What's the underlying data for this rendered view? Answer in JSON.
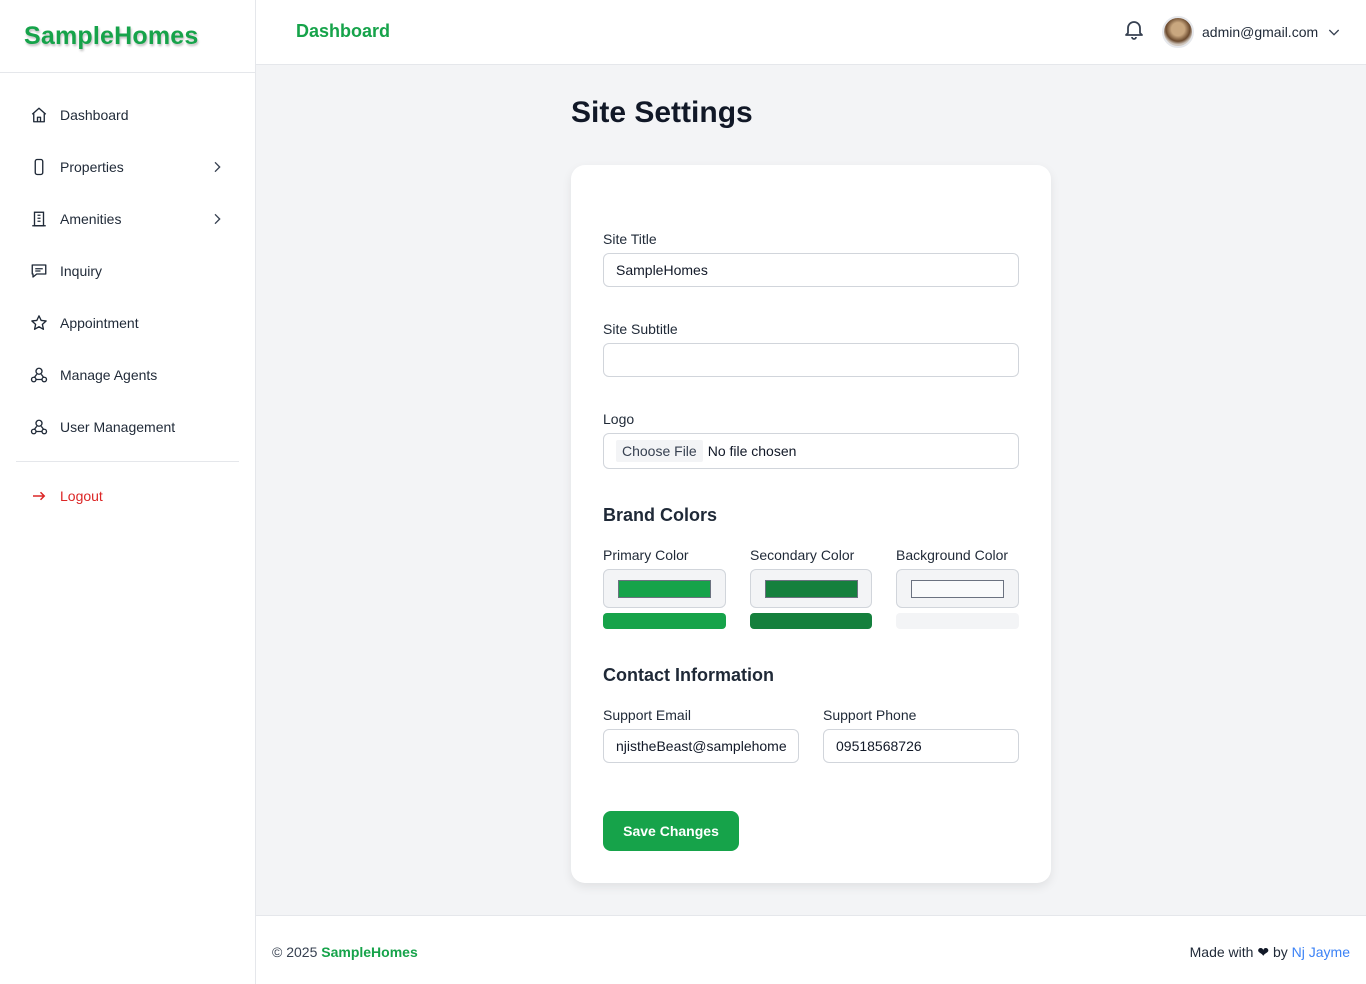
{
  "app": {
    "brand": "SampleHomes"
  },
  "sidebar": {
    "items": [
      {
        "label": "Dashboard",
        "icon": "home-icon"
      },
      {
        "label": "Properties",
        "icon": "phone-icon",
        "has_submenu": true
      },
      {
        "label": "Amenities",
        "icon": "building-icon",
        "has_submenu": true
      },
      {
        "label": "Inquiry",
        "icon": "message-icon"
      },
      {
        "label": "Appointment",
        "icon": "star-icon"
      },
      {
        "label": "Manage Agents",
        "icon": "agents-icon"
      },
      {
        "label": "User Management",
        "icon": "users-icon"
      }
    ],
    "logout": {
      "label": "Logout",
      "icon": "arrow-right-icon"
    }
  },
  "header": {
    "title": "Dashboard",
    "user_email": "admin@gmail.com"
  },
  "page": {
    "title": "Site Settings",
    "site_title": {
      "label": "Site Title",
      "value": "SampleHomes"
    },
    "site_subtitle": {
      "label": "Site Subtitle",
      "value": ""
    },
    "logo": {
      "label": "Logo",
      "button": "Choose File",
      "status": "No file chosen"
    },
    "brand_colors": {
      "heading": "Brand Colors",
      "primary": {
        "label": "Primary Color",
        "value": "#16a34a"
      },
      "secondary": {
        "label": "Secondary Color",
        "value": "#15803d"
      },
      "background": {
        "label": "Background Color",
        "value": "#f3f4f6"
      }
    },
    "contact": {
      "heading": "Contact Information",
      "email": {
        "label": "Support Email",
        "value": "njistheBeast@samplehomes.com"
      },
      "phone": {
        "label": "Support Phone",
        "value": "09518568726"
      }
    },
    "save_label": "Save Changes"
  },
  "footer": {
    "copyright": "© 2025",
    "brand": "SampleHomes",
    "made_with": "Made with",
    "heart": "❤",
    "by": "by",
    "author": "Nj Jayme"
  },
  "colors": {
    "accent": "#16a34a",
    "danger": "#dc2626",
    "link": "#3b82f6"
  }
}
